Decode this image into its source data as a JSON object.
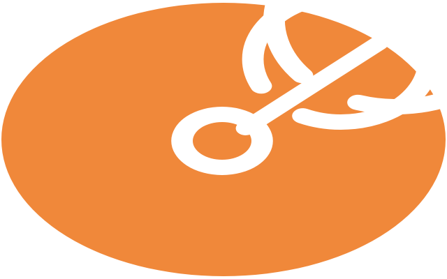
{
  "logo": {
    "icon": "target-radar-icon",
    "colors": {
      "disc": "#f0883a",
      "rings": "#ffffff",
      "background": "#ffffff"
    }
  }
}
